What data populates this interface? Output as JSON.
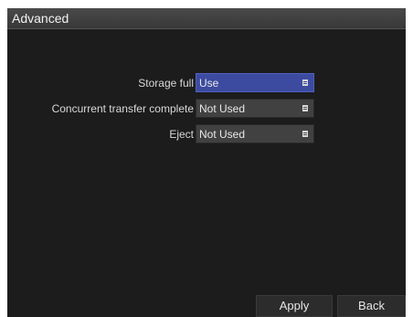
{
  "window": {
    "title": "Advanced"
  },
  "settings": [
    {
      "label": "Storage full",
      "value": "Use",
      "active": true
    },
    {
      "label": "Concurrent transfer complete",
      "value": "Not Used",
      "active": false
    },
    {
      "label": "Eject",
      "value": "Not Used",
      "active": false
    }
  ],
  "footer": {
    "apply_label": "Apply",
    "back_label": "Back"
  },
  "icons": {
    "dropdown": "dropdown-list-icon"
  },
  "colors": {
    "active_select": "#3c4ba0",
    "inactive_select": "#414141",
    "background": "#1c1c1c"
  }
}
